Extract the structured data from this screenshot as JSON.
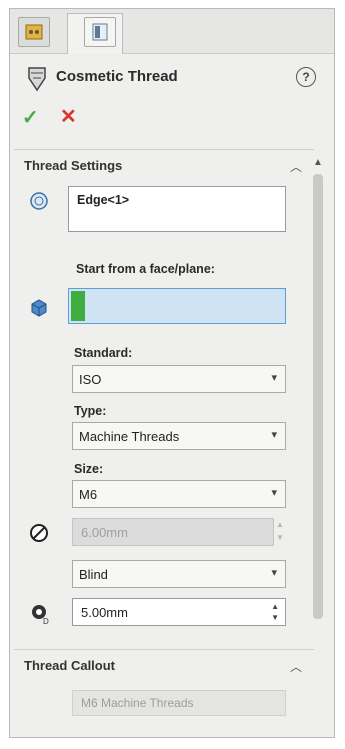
{
  "header": {
    "title": "Cosmetic Thread",
    "help_label": "?",
    "ok_label": "✓",
    "cancel_label": "✕"
  },
  "thread_settings": {
    "section_title": "Thread Settings",
    "edge_value": "Edge<1>",
    "start_label": "Start from a face/plane:",
    "standard_label": "Standard:",
    "standard_value": "ISO",
    "type_label": "Type:",
    "type_value": "Machine Threads",
    "size_label": "Size:",
    "size_value": "M6",
    "diameter_value": "6.00mm",
    "end_condition_value": "Blind",
    "depth_value": "5.00mm"
  },
  "thread_callout": {
    "section_title": "Thread Callout",
    "callout_value": "M6 Machine Threads"
  },
  "colors": {
    "accent_green": "#3fae3f",
    "selection_blue": "#cfe3f5",
    "cancel_red": "#d63a2a"
  }
}
